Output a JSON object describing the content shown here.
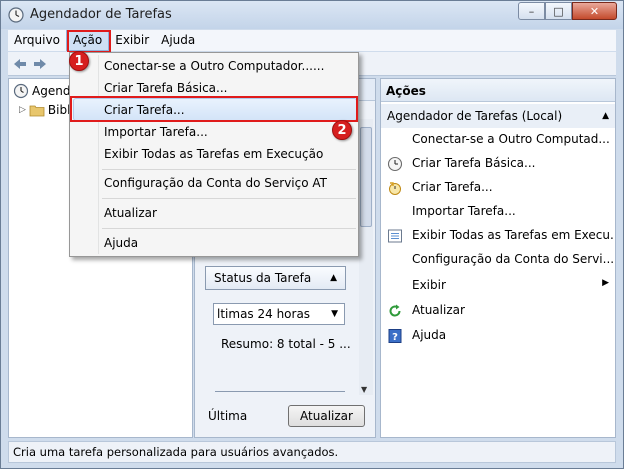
{
  "window": {
    "title": "Agendador de Tarefas",
    "min_symbol": "–",
    "max_symbol": "□",
    "close_symbol": "✕"
  },
  "menubar": [
    "Arquivo",
    "Ação",
    "Exibir",
    "Ajuda"
  ],
  "tree": {
    "root_label": "Agend",
    "child_label": "Bibl",
    "expander": "▷"
  },
  "dropdown": {
    "items": [
      "Conectar-se a Outro Computador......",
      "Criar Tarefa Básica...",
      "Criar Tarefa...",
      "Importar Tarefa...",
      "Exibir Todas as Tarefas em Execução",
      "Configuração da Conta do Serviço AT",
      "Atualizar",
      "Ajuda"
    ],
    "selected_index": 2
  },
  "badges": [
    "1",
    "2"
  ],
  "middle": {
    "status_button": "Status da Tarefa",
    "period": "ltimas 24 horas",
    "summary": "Resumo: 8 total - 5 ...",
    "last_label": "Última",
    "refresh_button": "Atualizar"
  },
  "actions": {
    "header": "Ações",
    "section": "Agendador de Tarefas (Local)",
    "items": [
      {
        "label": "Conectar-se a Outro Computad...",
        "icon": "none"
      },
      {
        "label": "Criar Tarefa Básica...",
        "icon": "clock-icon"
      },
      {
        "label": "Criar Tarefa...",
        "icon": "new-task-icon"
      },
      {
        "label": "Importar Tarefa...",
        "icon": "none"
      },
      {
        "label": "Exibir Todas as Tarefas em Execu...",
        "icon": "list-icon"
      },
      {
        "label": "Configuração da Conta do Servi...",
        "icon": "none"
      },
      {
        "label": "Exibir",
        "icon": "none",
        "submenu": true
      },
      {
        "label": "Atualizar",
        "icon": "refresh-icon"
      },
      {
        "label": "Ajuda",
        "icon": "help-icon"
      }
    ]
  },
  "statusbar": {
    "text": "Cria uma tarefa personalizada para usuários avançados."
  },
  "colors": {
    "highlight_red": "#e01b1b",
    "badge_red": "#d61f1f",
    "window_frame": "#cfdcec",
    "menu_selection": "#d4e4f8"
  }
}
